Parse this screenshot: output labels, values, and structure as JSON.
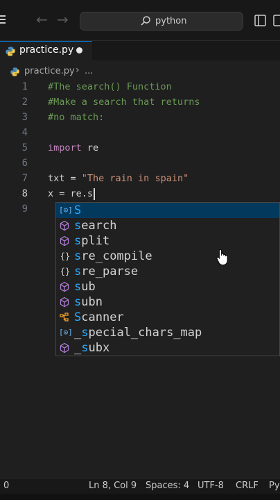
{
  "titlebar": {
    "search_text": "python",
    "icons": [
      "menu-icon",
      "arrow-left-icon",
      "arrow-right-icon",
      "search-icon",
      "layout-panel-icon",
      "layout-sidebar-icon"
    ]
  },
  "tab": {
    "label": "practice.py",
    "modified": true
  },
  "breadcrumb": {
    "file": "practice.py",
    "separator": "›",
    "ellipsis": "..."
  },
  "editor": {
    "lines": [
      {
        "num": "1",
        "text": "#The search() Function",
        "kind": "comment"
      },
      {
        "num": "2",
        "text": "#Make a search that returns",
        "kind": "comment"
      },
      {
        "num": "3",
        "text": "#no match:",
        "kind": "comment"
      },
      {
        "num": "4",
        "text": "",
        "kind": "blank"
      },
      {
        "num": "5",
        "keyword": "import",
        "rest": " re",
        "kind": "import"
      },
      {
        "num": "6",
        "text": "",
        "kind": "blank"
      },
      {
        "num": "7",
        "lhs": "txt = ",
        "string": "\"The rain in spain\"",
        "kind": "assign"
      },
      {
        "num": "8",
        "text": "x = re.s",
        "kind": "current"
      },
      {
        "num": "9",
        "text": "",
        "kind": "blank"
      }
    ]
  },
  "suggestions": [
    {
      "match": "S",
      "rest": "",
      "icon": "variable-icon",
      "selected": true
    },
    {
      "match": "s",
      "rest": "earch",
      "icon": "method-icon"
    },
    {
      "match": "s",
      "rest": "plit",
      "icon": "method-icon"
    },
    {
      "match": "s",
      "rest": "re_compile",
      "icon": "braces-icon"
    },
    {
      "match": "s",
      "rest": "re_parse",
      "icon": "braces-icon"
    },
    {
      "match": "s",
      "rest": "ub",
      "icon": "method-icon"
    },
    {
      "match": "s",
      "rest": "ubn",
      "icon": "method-icon"
    },
    {
      "match": "S",
      "rest": "canner",
      "icon": "class-icon"
    },
    {
      "prefix": "_",
      "match": "s",
      "rest": "pecial_chars_map",
      "icon": "variable-icon"
    },
    {
      "prefix": "_",
      "match": "s",
      "rest": "ubx",
      "icon": "method-icon"
    }
  ],
  "statusbar": {
    "problems": "0",
    "position": "Ln 8, Col 9",
    "spaces": "Spaces: 4",
    "encoding": "UTF-8",
    "eol": "CRLF",
    "language": "Py"
  },
  "colors": {
    "comment": "#6a9955",
    "keyword": "#c586c0",
    "string": "#ce9178",
    "match_highlight": "#2aaaff",
    "method_icon": "#b180d7",
    "class_icon": "#ee9d28",
    "variable_icon": "#75beff"
  }
}
